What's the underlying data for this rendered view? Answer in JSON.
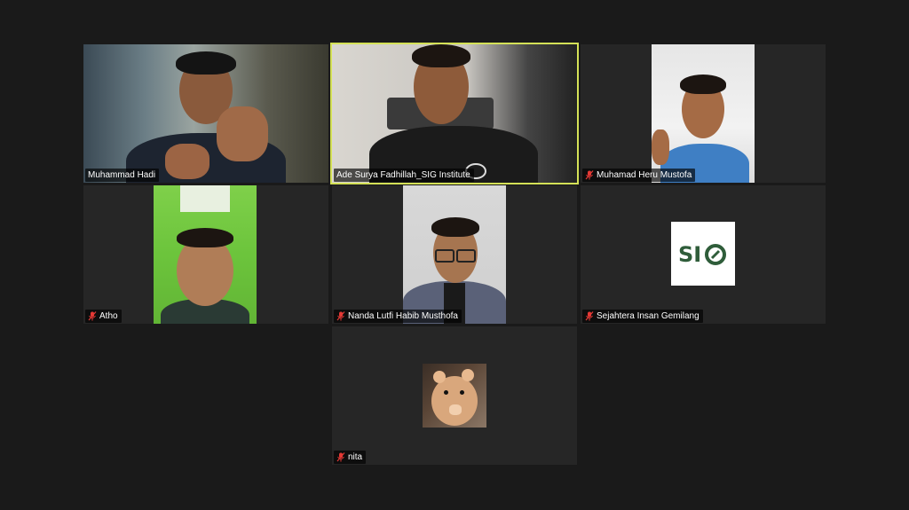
{
  "participants": [
    {
      "name": "Muhammad Hadi",
      "muted": false,
      "active": false
    },
    {
      "name": "Ade Surya Fadhillah_SIG Institute",
      "muted": false,
      "active": true
    },
    {
      "name": "Muhamad Heru Mustofa",
      "muted": true,
      "active": false
    },
    {
      "name": "Atho",
      "muted": true,
      "active": false
    },
    {
      "name": "Nanda Lutfi Habib Musthofa",
      "muted": true,
      "active": false
    },
    {
      "name": "Sejahtera Insan Gemilang",
      "muted": true,
      "active": false
    },
    {
      "name": "nita",
      "muted": true,
      "active": false
    }
  ],
  "logo": {
    "text": "SIG",
    "color": "#2f5d3a"
  },
  "colors": {
    "active_border": "#d4e157",
    "muted_icon": "#e53935",
    "tile_bg": "#262626",
    "page_bg": "#1a1a1a"
  },
  "icons": {
    "muted": "mic-muted-icon"
  }
}
